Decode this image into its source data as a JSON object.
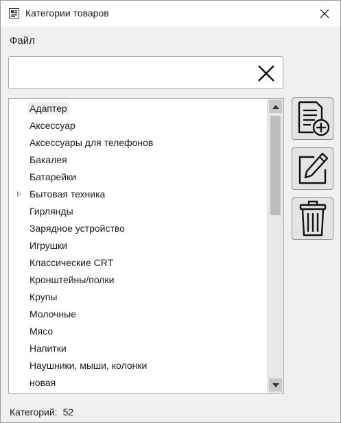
{
  "window": {
    "title": "Категории товаров"
  },
  "menu": {
    "file": "Файл"
  },
  "search": {
    "value": "",
    "placeholder": ""
  },
  "categories": [
    {
      "label": "Адаптер",
      "selected": true,
      "has_children": false
    },
    {
      "label": "Аксессуар",
      "selected": false,
      "has_children": false
    },
    {
      "label": "Аксессуары для телефонов",
      "selected": false,
      "has_children": false
    },
    {
      "label": "Бакалея",
      "selected": false,
      "has_children": false
    },
    {
      "label": "Батарейки",
      "selected": false,
      "has_children": false
    },
    {
      "label": "Бытовая техника",
      "selected": false,
      "has_children": true
    },
    {
      "label": "Гирлянды",
      "selected": false,
      "has_children": false
    },
    {
      "label": "Зарядное устройство",
      "selected": false,
      "has_children": false
    },
    {
      "label": "Игрушки",
      "selected": false,
      "has_children": false
    },
    {
      "label": "Классические CRT",
      "selected": false,
      "has_children": false
    },
    {
      "label": "Кронштейны/полки",
      "selected": false,
      "has_children": false
    },
    {
      "label": "Крупы",
      "selected": false,
      "has_children": false
    },
    {
      "label": "Молочные",
      "selected": false,
      "has_children": false
    },
    {
      "label": "Мясо",
      "selected": false,
      "has_children": false
    },
    {
      "label": "Напитки",
      "selected": false,
      "has_children": false
    },
    {
      "label": "Наушники, мыши, колонки",
      "selected": false,
      "has_children": false
    },
    {
      "label": "новая",
      "selected": false,
      "has_children": false
    }
  ],
  "toolbar": {
    "add_icon": "add-document-icon",
    "edit_icon": "edit-pencil-icon",
    "delete_icon": "trash-icon"
  },
  "status": {
    "label": "Категорий:",
    "count": "52"
  }
}
